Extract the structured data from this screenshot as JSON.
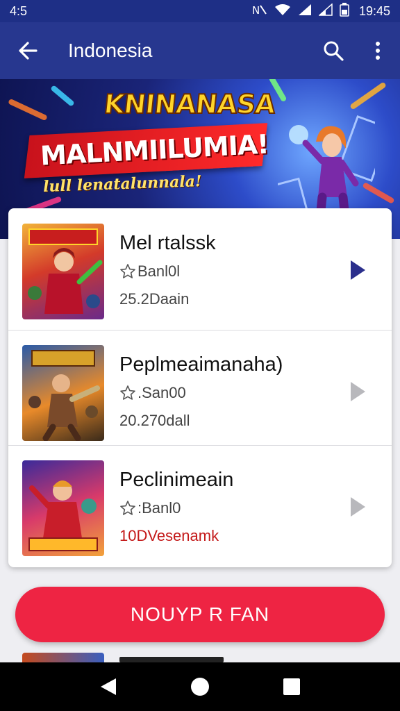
{
  "status_bar": {
    "left_text": "4:5",
    "time": "19:45"
  },
  "app_bar": {
    "title": "Indonesia"
  },
  "banner": {
    "headline": "KNINANASA",
    "ribbon_text": "MALNMIILUMIA!",
    "tagline": "lull lenatalunnala!"
  },
  "list": [
    {
      "title": "Mel rtalssk",
      "rating": "Banl0l",
      "meta": "25.2Daain",
      "meta_accent": false,
      "play_active": true
    },
    {
      "title": "Peplmeaimanaha)",
      "rating": ".San00",
      "meta": "20.270dall",
      "meta_accent": false,
      "play_active": false
    },
    {
      "title": "Peclinimeain",
      "rating": ":Banl0",
      "meta": "10DVesenamk",
      "meta_accent": true,
      "play_active": false
    }
  ],
  "cta": {
    "label": "NOUYP R FAN"
  },
  "colors": {
    "primary": "#27378f",
    "accent": "#ee2443",
    "play_active": "#2b2f8c",
    "play_inactive": "#b8b8bc"
  },
  "icons": [
    "back-arrow-icon",
    "search-icon",
    "more-vert-icon",
    "star-outline-icon",
    "play-icon",
    "nav-back-icon",
    "nav-home-icon",
    "nav-recents-icon"
  ]
}
